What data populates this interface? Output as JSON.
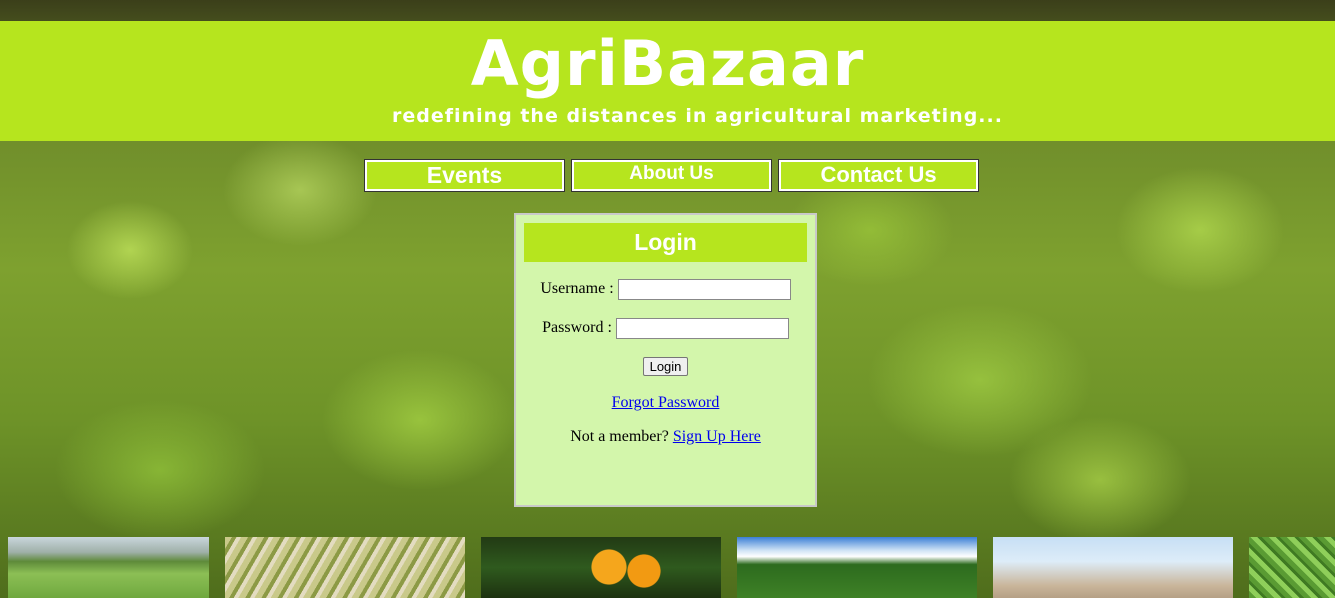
{
  "header": {
    "title": "AgriBazaar",
    "tagline": "redefining the distances in agricultural marketing..."
  },
  "nav": {
    "items": [
      {
        "label": "Events"
      },
      {
        "label": "About Us"
      },
      {
        "label": "Contact Us"
      }
    ]
  },
  "login": {
    "heading": "Login",
    "username_label": "Username :",
    "username_value": "",
    "password_label": "Password :",
    "password_value": "",
    "button_label": "Login",
    "forgot_link": "Forgot Password",
    "member_prompt": "Not a member?",
    "signup_link": "Sign Up Here"
  },
  "colors": {
    "accent": "#b6e51e",
    "panel": "#d3f6ab",
    "link": "#0000ee"
  },
  "gallery": {
    "images": [
      "field-photo",
      "herbs-photo",
      "oranges-photo",
      "farmland-photo",
      "sky-photo",
      "lettuce-photo"
    ]
  }
}
